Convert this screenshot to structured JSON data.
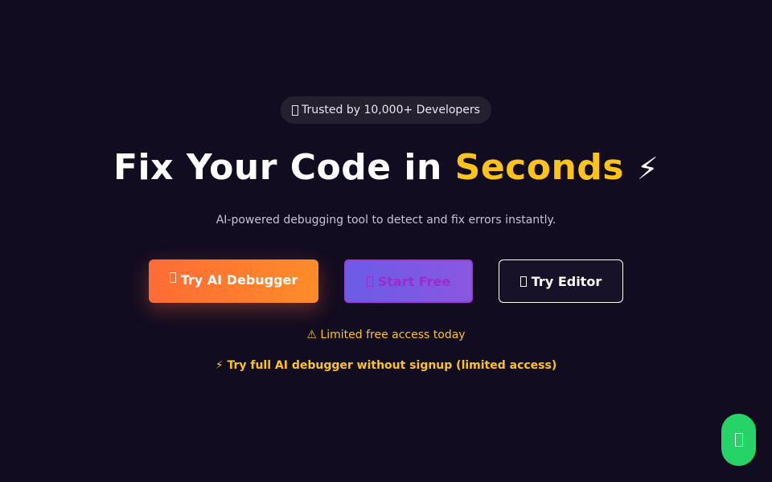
{
  "badge": {
    "icon": "tofu-glyph-icon",
    "text": "Trusted by 10,000+ Developers"
  },
  "headline": {
    "part1": "Fix Your Code in",
    "accent": "Seconds",
    "emoji": "⚡"
  },
  "subtitle": "AI-powered debugging tool to detect and fix errors instantly.",
  "buttons": {
    "debugger": {
      "icon": "tofu-glyph-icon",
      "label": "Try AI Debugger"
    },
    "start": {
      "icon": "tofu-glyph-icon",
      "label": "Start Free"
    },
    "editor": {
      "icon": "tofu-glyph-icon",
      "label": "Try Editor"
    }
  },
  "notice": "⚠ Limited free access today",
  "nosignup_link": "⚡ Try full AI debugger without signup (limited access)",
  "chat_fab": {
    "icon": "tofu-glyph-icon"
  },
  "colors": {
    "background": "#120c20",
    "accent_yellow": "#fcc419",
    "orange": "#ff6b35",
    "purple": "#6b5ce7",
    "green": "#25d366"
  }
}
